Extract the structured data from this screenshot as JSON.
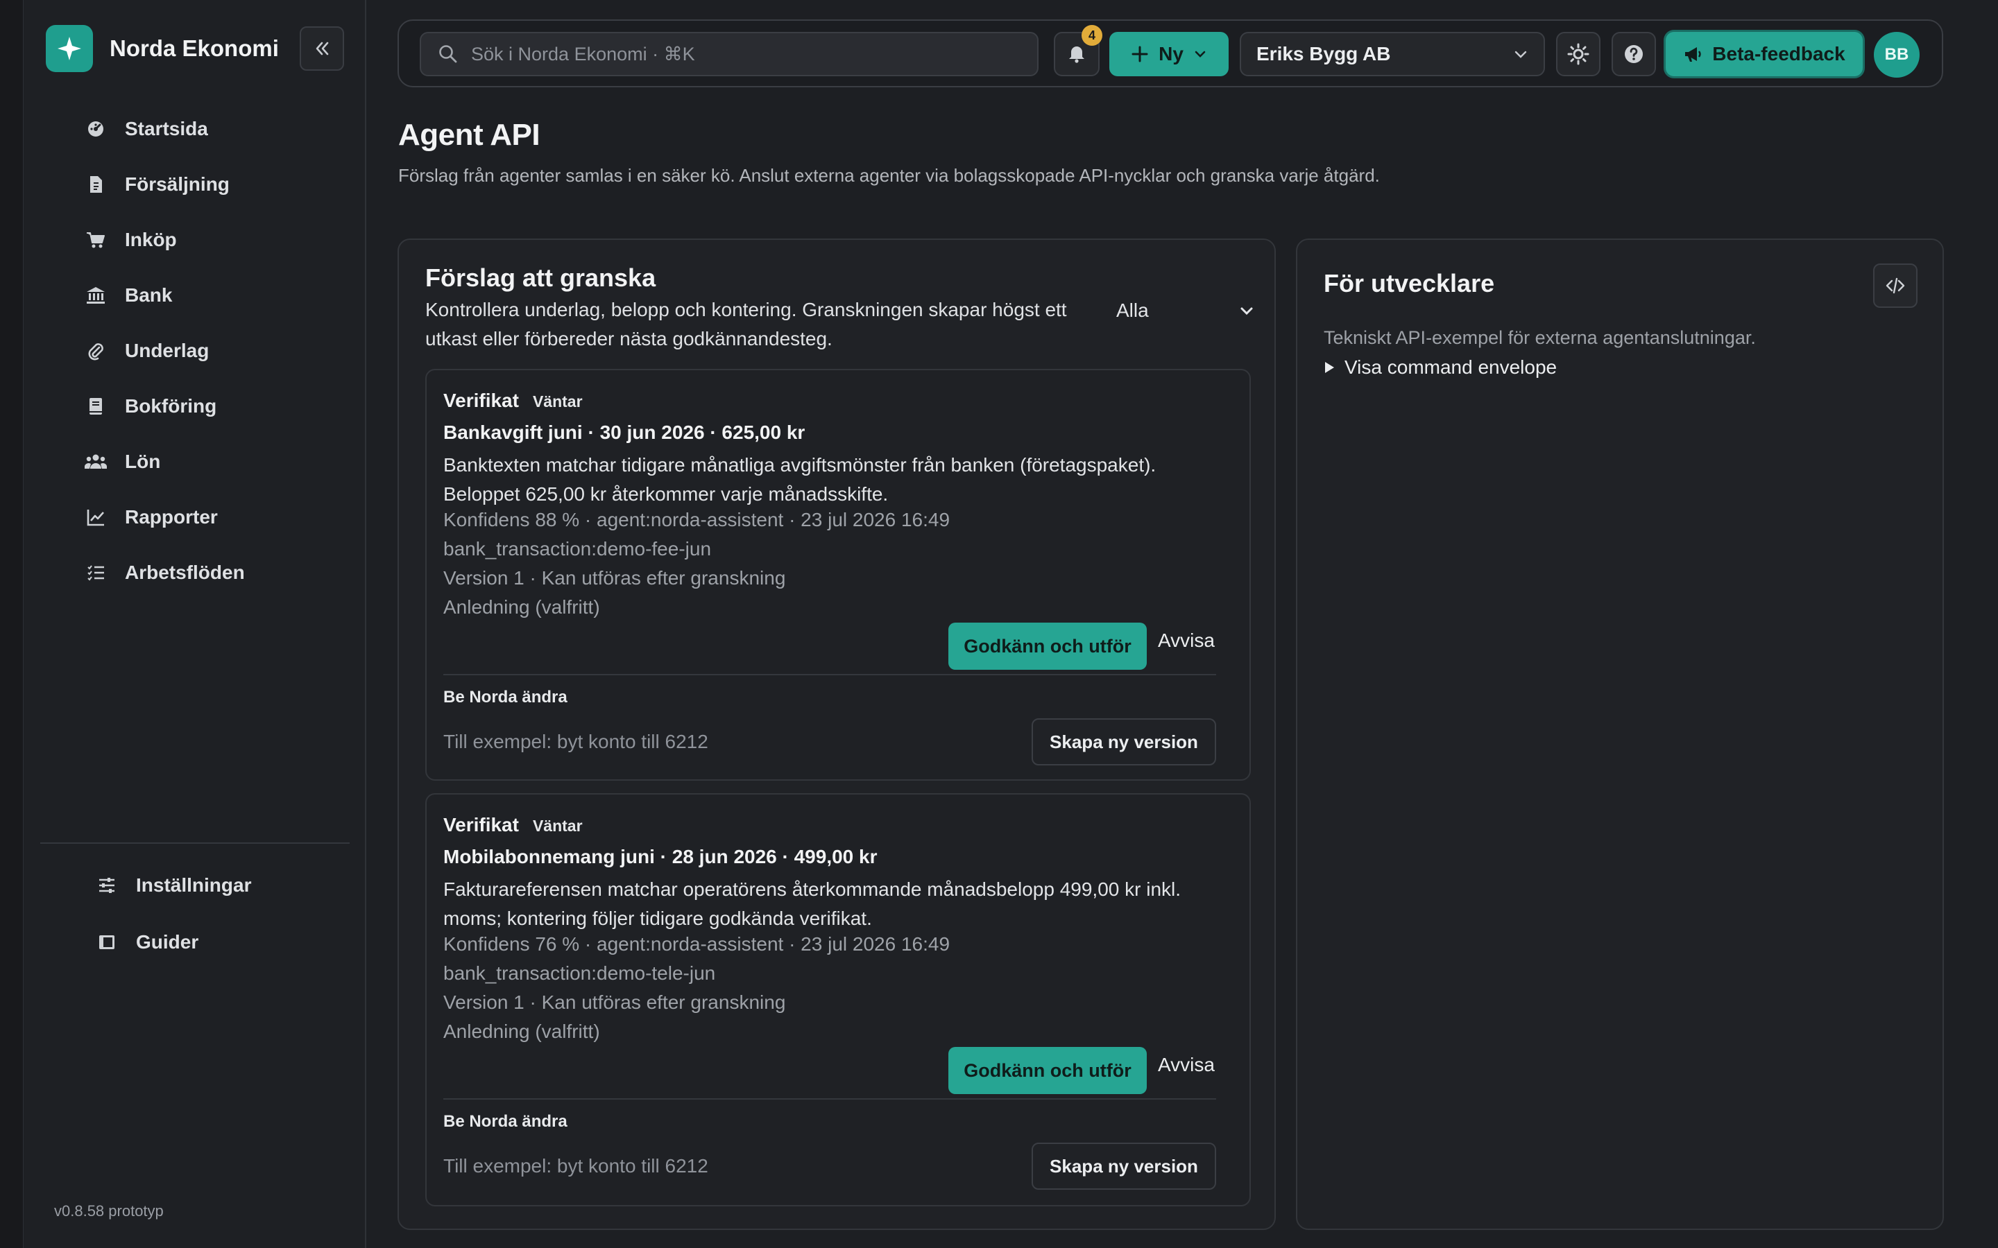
{
  "app": {
    "name": "Norda Ekonomi",
    "version": "v0.8.58 prototyp"
  },
  "sidebar": {
    "items": [
      {
        "label": "Startsida",
        "icon": "dashboard-icon"
      },
      {
        "label": "Försäljning",
        "icon": "invoice-icon"
      },
      {
        "label": "Inköp",
        "icon": "cart-icon"
      },
      {
        "label": "Bank",
        "icon": "bank-icon"
      },
      {
        "label": "Underlag",
        "icon": "paperclip-icon"
      },
      {
        "label": "Bokföring",
        "icon": "book-icon"
      },
      {
        "label": "Lön",
        "icon": "users-icon"
      },
      {
        "label": "Rapporter",
        "icon": "chart-icon"
      },
      {
        "label": "Arbetsflöden",
        "icon": "list-icon"
      }
    ],
    "bottom_items": [
      {
        "label": "Inställningar",
        "icon": "sliders-icon"
      },
      {
        "label": "Guider",
        "icon": "guide-book-icon"
      }
    ]
  },
  "topbar": {
    "search_placeholder": "Sök i Norda Ekonomi · ⌘K",
    "notification_count": "4",
    "new_label": "Ny",
    "company": "Eriks Bygg AB",
    "beta_label": "Beta-feedback",
    "avatar_initials": "BB"
  },
  "page": {
    "title": "Agent API",
    "description": "Förslag från agenter samlas i en säker kö. Anslut externa agenter via bolagsskopade API-nycklar och granska varje åtgärd."
  },
  "review": {
    "title": "Förslag att granska",
    "description": "Kontrollera underlag, belopp och kontering. Granskningen skapar högst ett utkast eller förbereder nästa godkännandesteg.",
    "filter_value": "Alla",
    "cards": [
      {
        "kind": "Verifikat",
        "status": "Väntar",
        "title": "Bankavgift juni · 30 jun 2026 · 625,00 kr",
        "description": "Banktexten matchar tidigare månatliga avgiftsmönster från banken (företagspaket). Beloppet 625,00 kr återkommer varje månadsskifte.",
        "meta": "Konfidens 88 % · agent:norda-assistent · 23 jul 2026 16:49",
        "reference": "bank_transaction:demo-fee-jun",
        "version": "Version 1 · Kan utföras efter granskning",
        "reason_placeholder": "Anledning (valfritt)",
        "approve_label": "Godkänn och utför",
        "reject_label": "Avvisa",
        "ask_label": "Be Norda ändra",
        "change_placeholder": "Till exempel: byt konto till 6212",
        "new_version_label": "Skapa ny version"
      },
      {
        "kind": "Verifikat",
        "status": "Väntar",
        "title": "Mobilabonnemang juni · 28 jun 2026 · 499,00 kr",
        "description": "Fakturareferensen matchar operatörens återkommande månadsbelopp 499,00 kr inkl. moms; kontering följer tidigare godkända verifikat.",
        "meta": "Konfidens 76 % · agent:norda-assistent · 23 jul 2026 16:49",
        "reference": "bank_transaction:demo-tele-jun",
        "version": "Version 1 · Kan utföras efter granskning",
        "reason_placeholder": "Anledning (valfritt)",
        "approve_label": "Godkänn och utför",
        "reject_label": "Avvisa",
        "ask_label": "Be Norda ändra",
        "change_placeholder": "Till exempel: byt konto till 6212",
        "new_version_label": "Skapa ny version"
      }
    ]
  },
  "developer": {
    "title": "För utvecklare",
    "description": "Tekniskt API-exempel för externa agentanslutningar.",
    "details_label": "Visa command envelope"
  },
  "colors": {
    "accent": "#26a593",
    "badge": "#e2ac3a",
    "background": "#1d1f23",
    "panel": "#202226"
  }
}
